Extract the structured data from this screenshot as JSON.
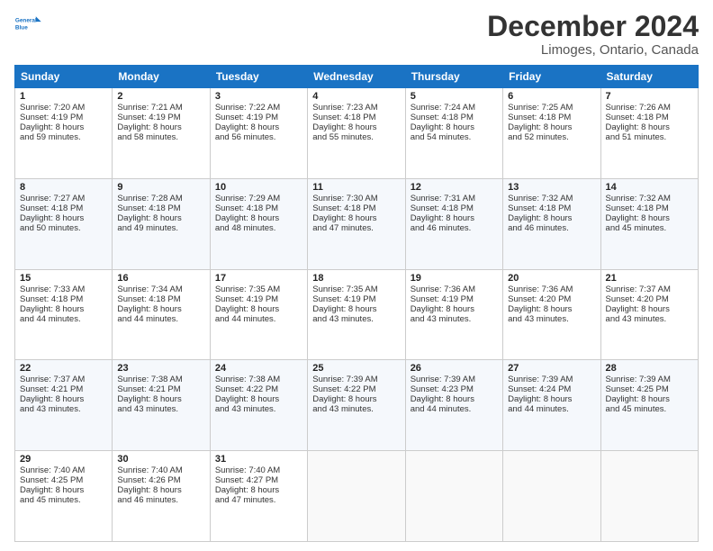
{
  "logo": {
    "line1": "General",
    "line2": "Blue"
  },
  "header": {
    "title": "December 2024",
    "subtitle": "Limoges, Ontario, Canada"
  },
  "columns": [
    "Sunday",
    "Monday",
    "Tuesday",
    "Wednesday",
    "Thursday",
    "Friday",
    "Saturday"
  ],
  "weeks": [
    [
      {
        "day": "1",
        "lines": [
          "Sunrise: 7:20 AM",
          "Sunset: 4:19 PM",
          "Daylight: 8 hours",
          "and 59 minutes."
        ]
      },
      {
        "day": "2",
        "lines": [
          "Sunrise: 7:21 AM",
          "Sunset: 4:19 PM",
          "Daylight: 8 hours",
          "and 58 minutes."
        ]
      },
      {
        "day": "3",
        "lines": [
          "Sunrise: 7:22 AM",
          "Sunset: 4:19 PM",
          "Daylight: 8 hours",
          "and 56 minutes."
        ]
      },
      {
        "day": "4",
        "lines": [
          "Sunrise: 7:23 AM",
          "Sunset: 4:18 PM",
          "Daylight: 8 hours",
          "and 55 minutes."
        ]
      },
      {
        "day": "5",
        "lines": [
          "Sunrise: 7:24 AM",
          "Sunset: 4:18 PM",
          "Daylight: 8 hours",
          "and 54 minutes."
        ]
      },
      {
        "day": "6",
        "lines": [
          "Sunrise: 7:25 AM",
          "Sunset: 4:18 PM",
          "Daylight: 8 hours",
          "and 52 minutes."
        ]
      },
      {
        "day": "7",
        "lines": [
          "Sunrise: 7:26 AM",
          "Sunset: 4:18 PM",
          "Daylight: 8 hours",
          "and 51 minutes."
        ]
      }
    ],
    [
      {
        "day": "8",
        "lines": [
          "Sunrise: 7:27 AM",
          "Sunset: 4:18 PM",
          "Daylight: 8 hours",
          "and 50 minutes."
        ]
      },
      {
        "day": "9",
        "lines": [
          "Sunrise: 7:28 AM",
          "Sunset: 4:18 PM",
          "Daylight: 8 hours",
          "and 49 minutes."
        ]
      },
      {
        "day": "10",
        "lines": [
          "Sunrise: 7:29 AM",
          "Sunset: 4:18 PM",
          "Daylight: 8 hours",
          "and 48 minutes."
        ]
      },
      {
        "day": "11",
        "lines": [
          "Sunrise: 7:30 AM",
          "Sunset: 4:18 PM",
          "Daylight: 8 hours",
          "and 47 minutes."
        ]
      },
      {
        "day": "12",
        "lines": [
          "Sunrise: 7:31 AM",
          "Sunset: 4:18 PM",
          "Daylight: 8 hours",
          "and 46 minutes."
        ]
      },
      {
        "day": "13",
        "lines": [
          "Sunrise: 7:32 AM",
          "Sunset: 4:18 PM",
          "Daylight: 8 hours",
          "and 46 minutes."
        ]
      },
      {
        "day": "14",
        "lines": [
          "Sunrise: 7:32 AM",
          "Sunset: 4:18 PM",
          "Daylight: 8 hours",
          "and 45 minutes."
        ]
      }
    ],
    [
      {
        "day": "15",
        "lines": [
          "Sunrise: 7:33 AM",
          "Sunset: 4:18 PM",
          "Daylight: 8 hours",
          "and 44 minutes."
        ]
      },
      {
        "day": "16",
        "lines": [
          "Sunrise: 7:34 AM",
          "Sunset: 4:18 PM",
          "Daylight: 8 hours",
          "and 44 minutes."
        ]
      },
      {
        "day": "17",
        "lines": [
          "Sunrise: 7:35 AM",
          "Sunset: 4:19 PM",
          "Daylight: 8 hours",
          "and 44 minutes."
        ]
      },
      {
        "day": "18",
        "lines": [
          "Sunrise: 7:35 AM",
          "Sunset: 4:19 PM",
          "Daylight: 8 hours",
          "and 43 minutes."
        ]
      },
      {
        "day": "19",
        "lines": [
          "Sunrise: 7:36 AM",
          "Sunset: 4:19 PM",
          "Daylight: 8 hours",
          "and 43 minutes."
        ]
      },
      {
        "day": "20",
        "lines": [
          "Sunrise: 7:36 AM",
          "Sunset: 4:20 PM",
          "Daylight: 8 hours",
          "and 43 minutes."
        ]
      },
      {
        "day": "21",
        "lines": [
          "Sunrise: 7:37 AM",
          "Sunset: 4:20 PM",
          "Daylight: 8 hours",
          "and 43 minutes."
        ]
      }
    ],
    [
      {
        "day": "22",
        "lines": [
          "Sunrise: 7:37 AM",
          "Sunset: 4:21 PM",
          "Daylight: 8 hours",
          "and 43 minutes."
        ]
      },
      {
        "day": "23",
        "lines": [
          "Sunrise: 7:38 AM",
          "Sunset: 4:21 PM",
          "Daylight: 8 hours",
          "and 43 minutes."
        ]
      },
      {
        "day": "24",
        "lines": [
          "Sunrise: 7:38 AM",
          "Sunset: 4:22 PM",
          "Daylight: 8 hours",
          "and 43 minutes."
        ]
      },
      {
        "day": "25",
        "lines": [
          "Sunrise: 7:39 AM",
          "Sunset: 4:22 PM",
          "Daylight: 8 hours",
          "and 43 minutes."
        ]
      },
      {
        "day": "26",
        "lines": [
          "Sunrise: 7:39 AM",
          "Sunset: 4:23 PM",
          "Daylight: 8 hours",
          "and 44 minutes."
        ]
      },
      {
        "day": "27",
        "lines": [
          "Sunrise: 7:39 AM",
          "Sunset: 4:24 PM",
          "Daylight: 8 hours",
          "and 44 minutes."
        ]
      },
      {
        "day": "28",
        "lines": [
          "Sunrise: 7:39 AM",
          "Sunset: 4:25 PM",
          "Daylight: 8 hours",
          "and 45 minutes."
        ]
      }
    ],
    [
      {
        "day": "29",
        "lines": [
          "Sunrise: 7:40 AM",
          "Sunset: 4:25 PM",
          "Daylight: 8 hours",
          "and 45 minutes."
        ]
      },
      {
        "day": "30",
        "lines": [
          "Sunrise: 7:40 AM",
          "Sunset: 4:26 PM",
          "Daylight: 8 hours",
          "and 46 minutes."
        ]
      },
      {
        "day": "31",
        "lines": [
          "Sunrise: 7:40 AM",
          "Sunset: 4:27 PM",
          "Daylight: 8 hours",
          "and 47 minutes."
        ]
      },
      null,
      null,
      null,
      null
    ]
  ]
}
